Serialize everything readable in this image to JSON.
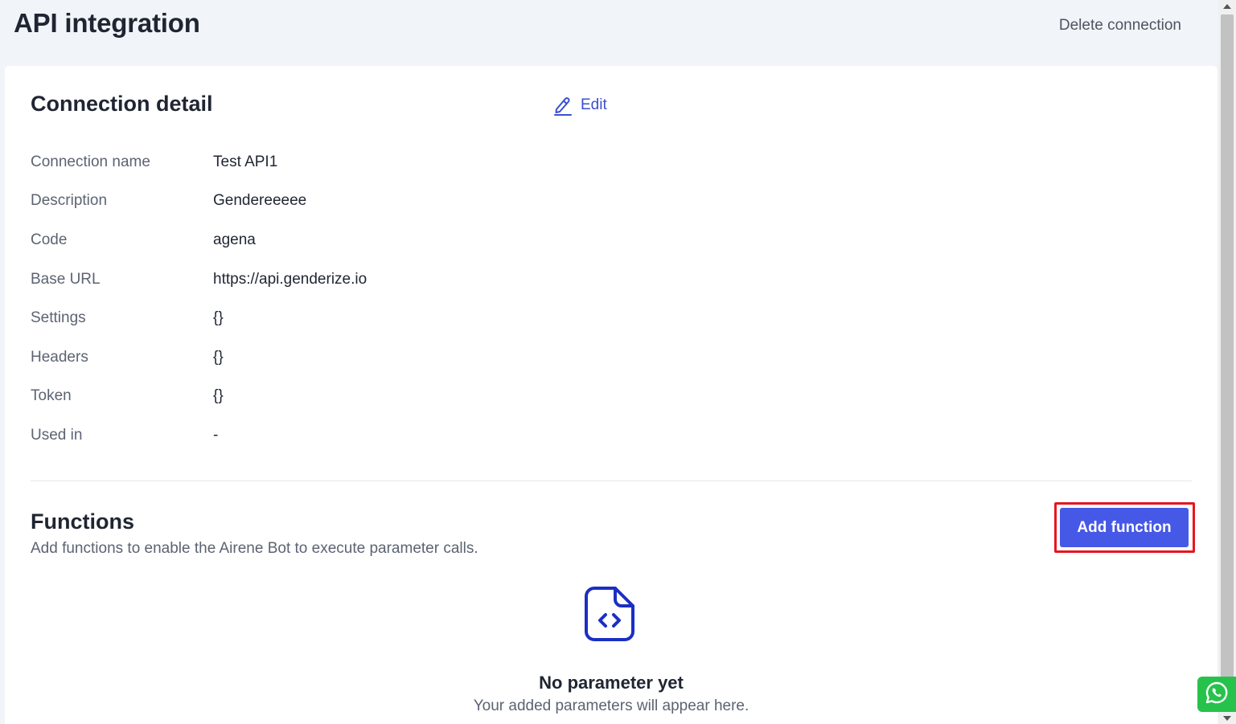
{
  "header": {
    "title": "API integration",
    "delete_label": "Delete connection"
  },
  "connection": {
    "section_title": "Connection detail",
    "edit_label": "Edit",
    "rows": [
      {
        "label": "Connection name",
        "value": "Test API1"
      },
      {
        "label": "Description",
        "value": "Gendereeeee"
      },
      {
        "label": "Code",
        "value": "agena"
      },
      {
        "label": "Base URL",
        "value": "https://api.genderize.io"
      },
      {
        "label": "Settings",
        "value": "{}"
      },
      {
        "label": "Headers",
        "value": "{}"
      },
      {
        "label": "Token",
        "value": "{}"
      },
      {
        "label": "Used in",
        "value": "-"
      }
    ]
  },
  "functions": {
    "title": "Functions",
    "subtitle": "Add functions to enable the Airene Bot to execute parameter calls.",
    "add_label": "Add function",
    "empty_title": "No parameter yet",
    "empty_subtitle": "Your added parameters will appear here."
  },
  "icons": {
    "edit": "pencil-icon",
    "empty": "code-file-icon",
    "chat": "whatsapp-icon"
  },
  "colors": {
    "accent": "#4659e6",
    "link": "#3a4fd1",
    "highlight": "#e8141f",
    "whatsapp": "#27c24c",
    "background": "#f1f4f8"
  }
}
